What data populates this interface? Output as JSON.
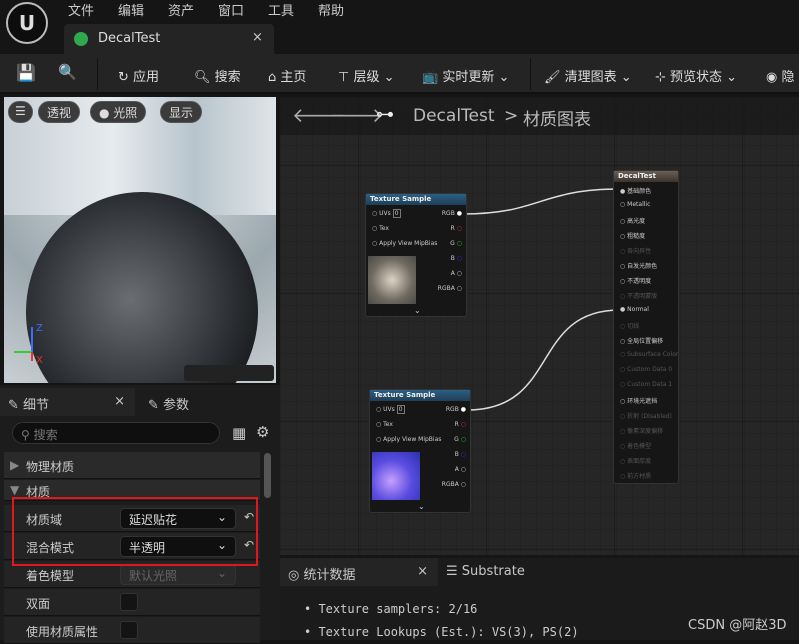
{
  "menu": [
    "文件",
    "编辑",
    "资产",
    "窗口",
    "工具",
    "帮助"
  ],
  "tab": {
    "title": "DecalTest",
    "close": "×"
  },
  "toolbar": {
    "apply": "应用",
    "search": "搜索",
    "home": "主页",
    "hierarchy": "层级",
    "live_update": "实时更新",
    "clean_graph": "清理图表",
    "preview_state": "预览状态",
    "hide": "隐"
  },
  "viewport": {
    "menu": "☰",
    "perspective": "透视",
    "lighting": "光照",
    "show": "显示",
    "axis_z": "Z",
    "axis_x": "X"
  },
  "graph": {
    "breadcrumb_asset": "DecalTest",
    "breadcrumb_sep": ">",
    "breadcrumb_graph": "材质图表",
    "texture_nodes": [
      {
        "title": "Texture Sample",
        "uvs": "UVs",
        "uv_val": "0",
        "tex": "Tex",
        "mip": "Apply View MipBias",
        "outputs": [
          "RGB",
          "R",
          "G",
          "B",
          "A",
          "RGBA"
        ]
      },
      {
        "title": "Texture Sample",
        "uvs": "UVs",
        "uv_val": "0",
        "tex": "Tex",
        "mip": "Apply View MipBias",
        "outputs": [
          "RGB",
          "R",
          "G",
          "B",
          "A",
          "RGBA"
        ]
      }
    ],
    "result_node": {
      "title": "DecalTest",
      "pins": [
        {
          "label": "基础颜色",
          "enabled": true,
          "connected": true
        },
        {
          "label": "Metallic",
          "enabled": true
        },
        {
          "label": "高光度",
          "enabled": true
        },
        {
          "label": "粗糙度",
          "enabled": true
        },
        {
          "label": "各向异性",
          "enabled": false
        },
        {
          "label": "自发光颜色",
          "enabled": true
        },
        {
          "label": "不透明度",
          "enabled": true
        },
        {
          "label": "不透明蒙版",
          "enabled": false
        },
        {
          "label": "Normal",
          "enabled": true,
          "connected": true
        },
        {
          "label": "切线",
          "enabled": false
        },
        {
          "label": "全局位置偏移",
          "enabled": true
        },
        {
          "label": "Subsurface Color",
          "enabled": false
        },
        {
          "label": "Custom Data 0",
          "enabled": false
        },
        {
          "label": "Custom Data 1",
          "enabled": false
        },
        {
          "label": "环境光遮挡",
          "enabled": true
        },
        {
          "label": "折射 (Disabled)",
          "enabled": false
        },
        {
          "label": "像素深度偏移",
          "enabled": false
        },
        {
          "label": "着色模型",
          "enabled": false
        },
        {
          "label": "表面厚度",
          "enabled": false
        },
        {
          "label": "前方材质",
          "enabled": false
        }
      ]
    }
  },
  "details": {
    "tab_details": "细节",
    "tab_params": "参数",
    "close": "×",
    "search_placeholder": "搜索",
    "cat_physical": "物理材质",
    "cat_material": "材质",
    "rows": [
      {
        "label": "材质域",
        "value": "延迟贴花"
      },
      {
        "label": "混合模式",
        "value": "半透明"
      },
      {
        "label": "着色模型",
        "value": "默认光照"
      },
      {
        "label": "双面"
      },
      {
        "label": "使用材质属性"
      }
    ]
  },
  "stats": {
    "tab_stats": "统计数据",
    "tab_substrate": "Substrate",
    "close": "×",
    "lines": [
      "Texture samplers: 2/16",
      "Texture Lookups (Est.): VS(3), PS(2)"
    ]
  },
  "watermark": "CSDN @阿赵3D"
}
